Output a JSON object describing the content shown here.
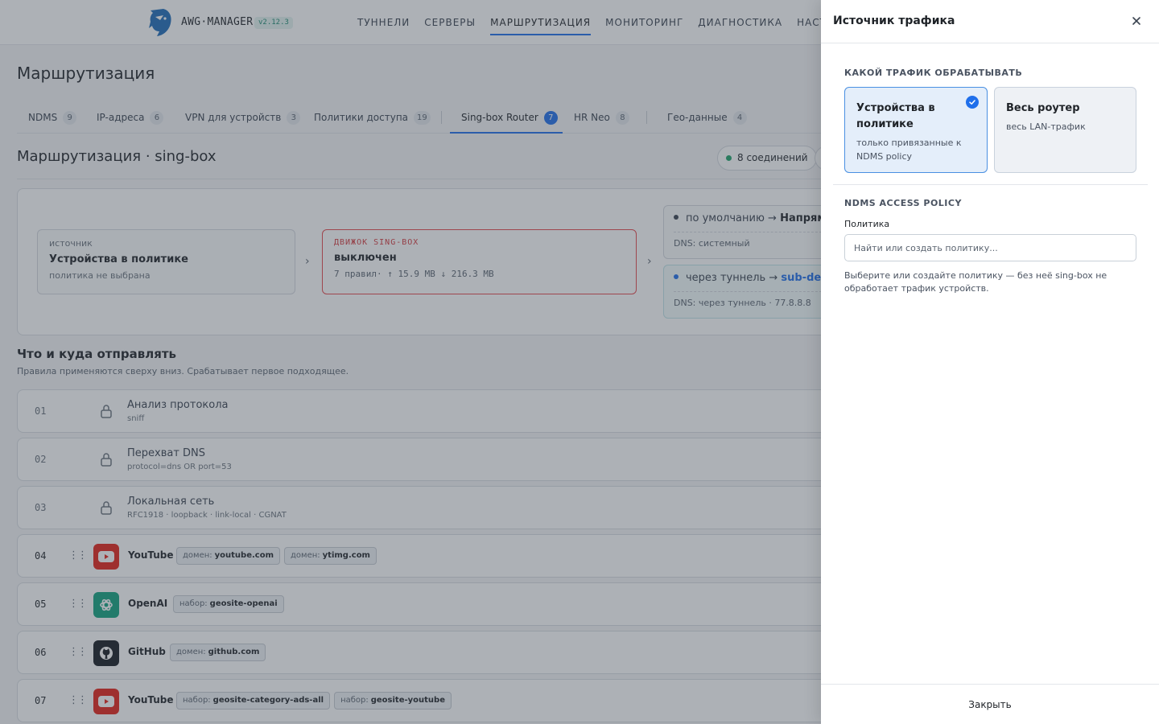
{
  "header": {
    "brand": "AWG·MANAGER",
    "version": "v2.12.3",
    "nav": [
      "ТУННЕЛИ",
      "СЕРВЕРЫ",
      "МАРШРУТИЗАЦИЯ",
      "МОНИТОРИНГ",
      "ДИАГНОСТИКА",
      "НАСТРОЙКИ"
    ],
    "active_nav": "МАРШРУТИЗАЦИЯ"
  },
  "page": {
    "title": "Маршрутизация",
    "subtabs": [
      {
        "label": "NDMS",
        "count": "9"
      },
      {
        "label": "IP-адреса",
        "count": "6"
      },
      {
        "label": "VPN для устройств",
        "count": "3"
      },
      {
        "label": "Политики доступа",
        "count": "19"
      },
      {
        "label": "Sing-box Router",
        "count": "7",
        "active": true
      },
      {
        "label": "HR Neo",
        "count": "8"
      },
      {
        "label": "Гео-данные",
        "count": "4"
      }
    ],
    "section_title": "Маршрутизация · sing-box",
    "connections": "8 соединений"
  },
  "flow": {
    "source": {
      "label": "источник",
      "value": "Устройства в политике",
      "sub": "политика не выбрана"
    },
    "engine": {
      "label": "ДВИЖОК SING-BOX",
      "value": "выключен",
      "sub": "7 правил· ↑ 15.9 MB ↓ 216.3 MB"
    },
    "default_route": {
      "prefix": "по умолчанию →",
      "target": "Напрямую",
      "dns": "DNS: системный"
    },
    "tunnel_route": {
      "prefix": "через туннель →",
      "target": "sub-demo",
      "dns": "DNS: через туннель · 77.8.8.8"
    }
  },
  "rules": {
    "title": "Что и куда отправлять",
    "subtitle": "Правила применяются сверху вниз. Срабатывает первое подходящее.",
    "locked": [
      {
        "num": "01",
        "name": "Анализ протокола",
        "meta": "sniff"
      },
      {
        "num": "02",
        "name": "Перехват DNS",
        "meta": "protocol=dns OR port=53"
      },
      {
        "num": "03",
        "name": "Локальная сеть",
        "meta": "RFC1918 · loopback · link-local · CGNAT"
      }
    ],
    "user": [
      {
        "num": "04",
        "app": "YouTube",
        "icon": "youtube-icon",
        "color": "#e62117",
        "chips": [
          {
            "k": "домен:",
            "v": "youtube.com"
          },
          {
            "k": "домен:",
            "v": "ytimg.com"
          }
        ]
      },
      {
        "num": "05",
        "app": "OpenAI",
        "icon": "openai-icon",
        "color": "#10a37f",
        "chips": [
          {
            "k": "набор:",
            "v": "geosite-openai"
          }
        ]
      },
      {
        "num": "06",
        "app": "GitHub",
        "icon": "github-icon",
        "color": "#161b22",
        "chips": [
          {
            "k": "домен:",
            "v": "github.com"
          }
        ]
      },
      {
        "num": "07",
        "app": "YouTube",
        "icon": "youtube-icon",
        "color": "#e62117",
        "chips": [
          {
            "k": "набор:",
            "v": "geosite-category-ads-all"
          },
          {
            "k": "набор:",
            "v": "geosite-youtube"
          }
        ]
      }
    ]
  },
  "drawer": {
    "title": "Источник трафика",
    "traffic_label": "КАКОЙ ТРАФИК ОБРАБАТЫВАТЬ",
    "options": [
      {
        "title": "Устройства в политике",
        "sub": "только привязанные к NDMS policy",
        "selected": true
      },
      {
        "title": "Весь роутер",
        "sub": "весь LAN-трафик",
        "selected": false
      }
    ],
    "policy_section": "NDMS ACCESS POLICY",
    "policy_label": "Политика",
    "policy_placeholder": "Найти или создать политику...",
    "policy_value": "",
    "hint": "Выберите или создайте политику — без неё sing-box не обработает трафик устройств.",
    "close_label": "Закрыть"
  },
  "colors": {
    "accent": "#1f6feb",
    "engine_off": "#e5484d",
    "status_ok": "#20a36a"
  }
}
